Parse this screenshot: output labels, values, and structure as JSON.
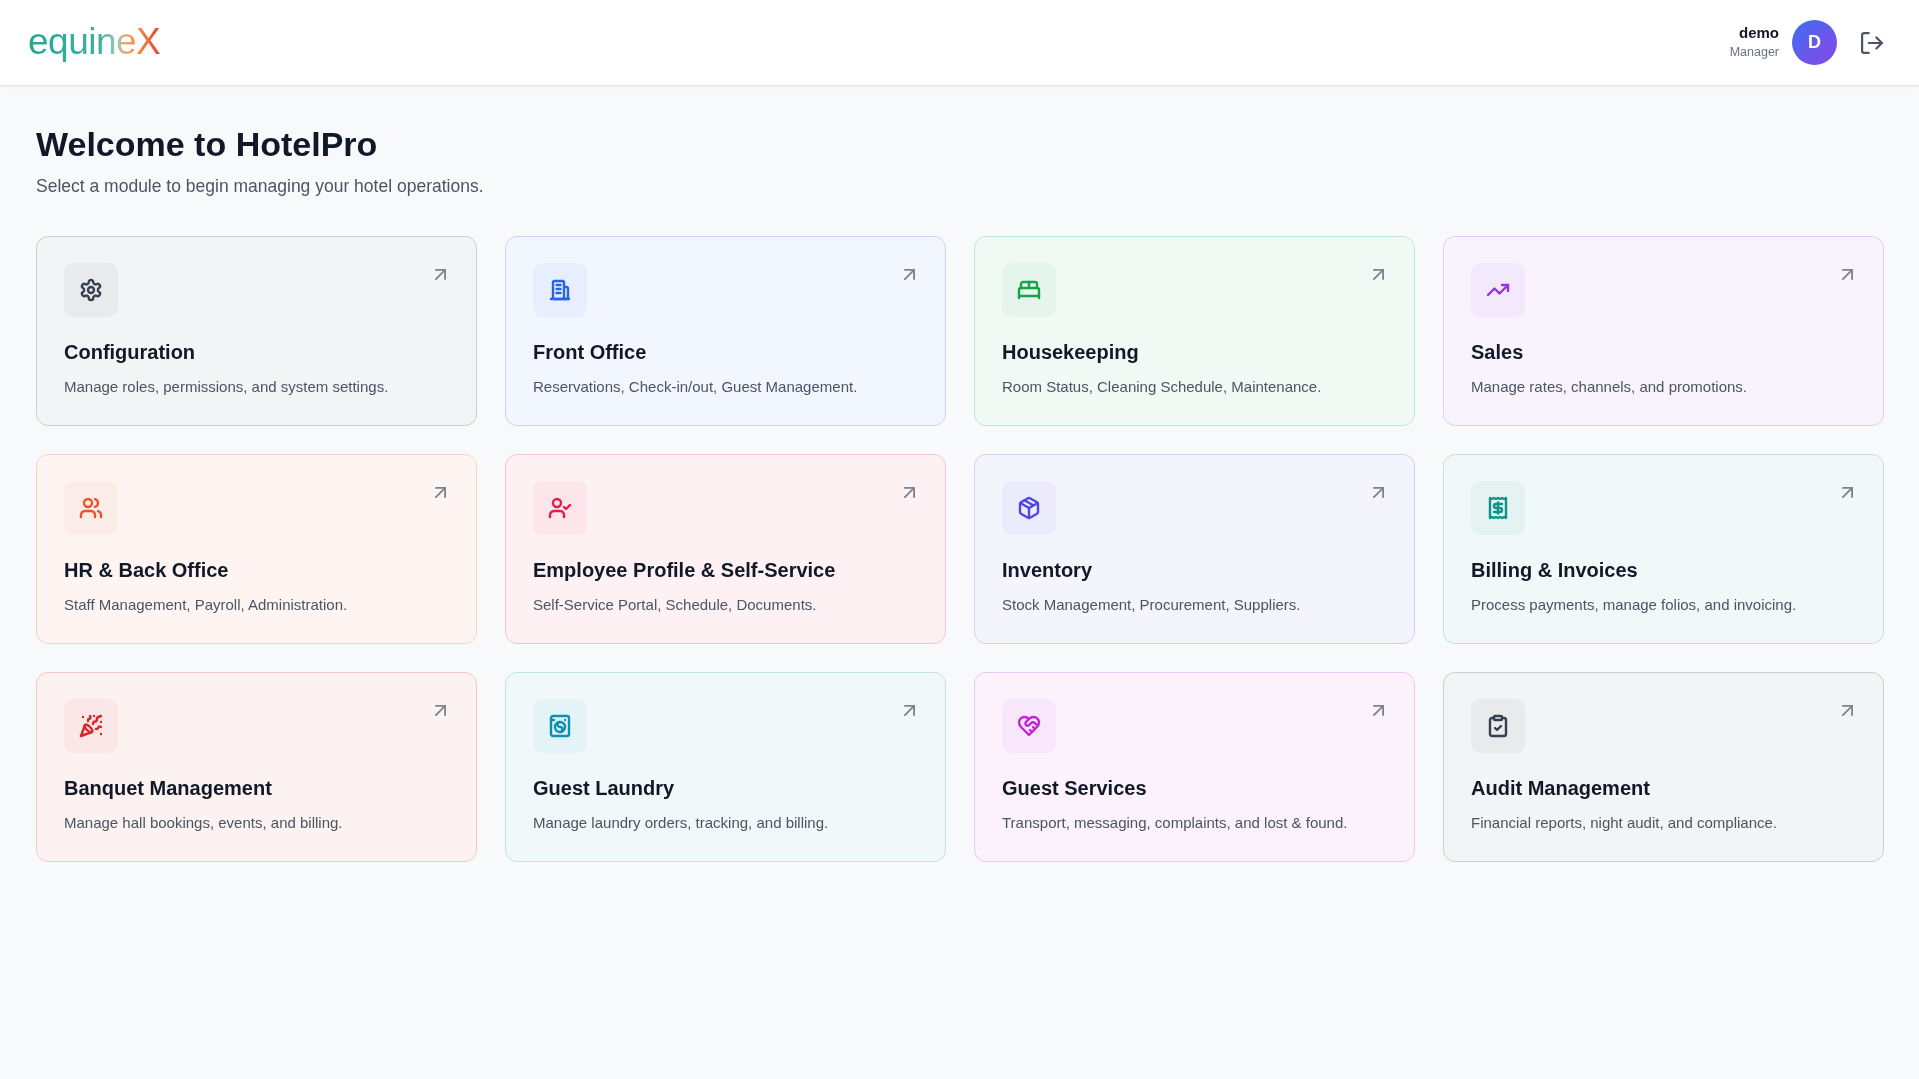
{
  "header": {
    "logo": "equineX",
    "user": {
      "name": "demo",
      "role": "Manager",
      "initial": "D"
    }
  },
  "welcome": {
    "title": "Welcome to HotelPro",
    "subtitle": "Select a module to begin managing your hotel operations."
  },
  "modules": [
    {
      "kind": "settings",
      "title": "Configuration",
      "description": "Manage roles, permissions, and system settings.",
      "color": "#374151"
    },
    {
      "kind": "reception",
      "title": "Front Office",
      "description": "Reservations, Check-in/out, Guest Management.",
      "color": "#2563eb"
    },
    {
      "kind": "housekeeping",
      "title": "Housekeeping",
      "description": "Room Status, Cleaning Schedule, Maintenance.",
      "color": "#16a34a"
    },
    {
      "kind": "sales",
      "title": "Sales",
      "description": "Manage rates, channels, and promotions.",
      "color": "#9333ea"
    },
    {
      "kind": "staff",
      "title": "HR & Back Office",
      "description": "Staff Management, Payroll, Administration.",
      "color": "#e8552a"
    },
    {
      "kind": "employee",
      "title": "Employee Profile & Self-Service",
      "description": "Self-Service Portal, Schedule, Documents.",
      "color": "#e11d48"
    },
    {
      "kind": "inventory",
      "title": "Inventory",
      "description": "Stock Management, Procurement, Suppliers.",
      "color": "#4f46e5"
    },
    {
      "kind": "billing",
      "title": "Billing & Invoices",
      "description": "Process payments, manage folios, and invoicing.",
      "color": "#0d9488"
    },
    {
      "kind": "banquet",
      "title": "Banquet Management",
      "description": "Manage hall bookings, events, and billing.",
      "color": "#dc2626"
    },
    {
      "kind": "laundry",
      "title": "Guest Laundry",
      "description": "Manage laundry orders, tracking, and billing.",
      "color": "#0891b2"
    },
    {
      "kind": "services",
      "title": "Guest Services",
      "description": "Transport, messaging, complaints, and lost & found.",
      "color": "#c026d3"
    },
    {
      "kind": "audit",
      "title": "Audit Management",
      "description": "Financial reports, night audit, and compliance.",
      "color": "#374151"
    }
  ]
}
